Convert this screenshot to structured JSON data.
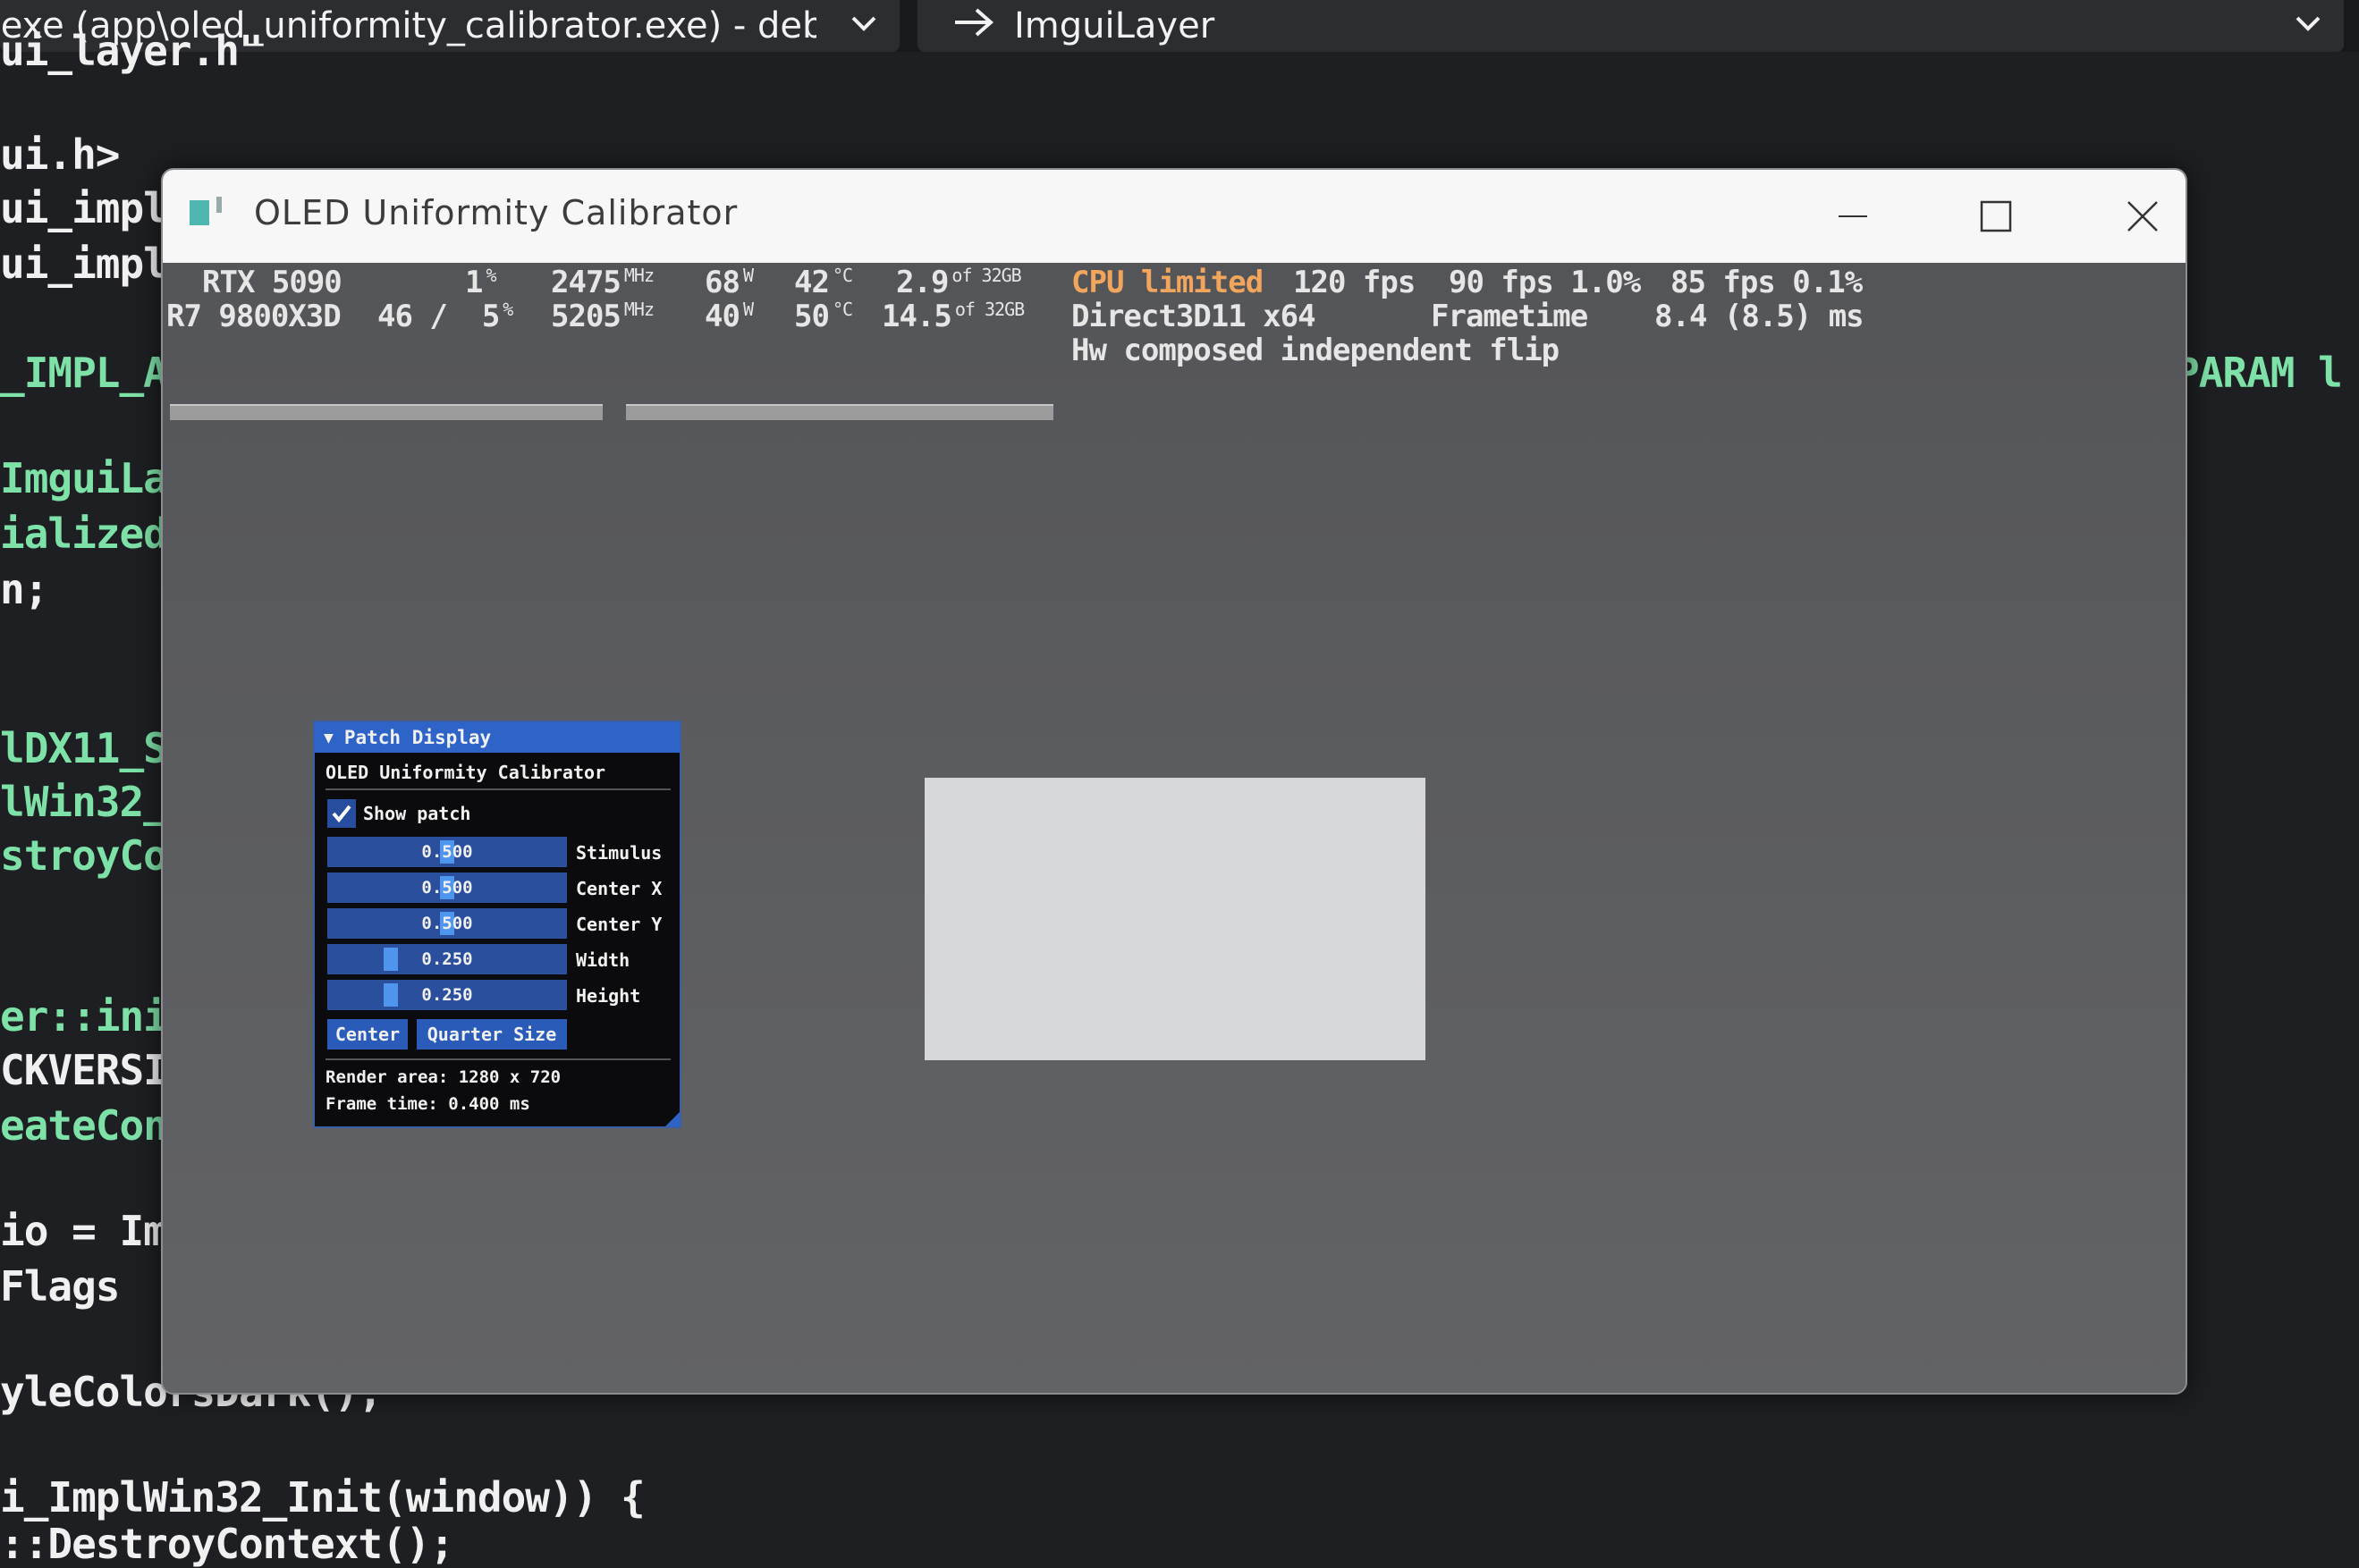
{
  "ide": {
    "config_dropdown": ".exe (app\\oled_uniformity_calibrator.exe) - debu",
    "member_dropdown": "ImguiLayer",
    "code_lines_left": [
      "ui_layer.h\"",
      "ui.h>",
      "ui_impl",
      "ui_impl",
      "_IMPL_AP",
      "ImguiLa",
      "ialized",
      "n;",
      "lDX11_S",
      "lWin32_",
      "stroyCo",
      "er::ini",
      "CKVERSI",
      "eateCon",
      "io = Im",
      "Flags",
      "yleColorsDark();",
      "i_ImplWin32_Init(window)) {",
      "::DestroyContext();"
    ],
    "code_right": "PARAM l"
  },
  "window": {
    "title": "OLED Uniformity Calibrator"
  },
  "overlay": {
    "gpu": {
      "name": "RTX 5090",
      "load": "1",
      "clock": "2475",
      "power": "68",
      "temp": "42",
      "mem": "2.9",
      "mem_total": "of 32GB"
    },
    "cpu": {
      "name": "R7 9800X3D",
      "load": "46 /  5",
      "clock": "5205",
      "power": "40",
      "temp": "50",
      "mem": "14.5",
      "mem_total": "of 32GB"
    },
    "units": {
      "pct": "%",
      "mhz": "MHz",
      "w": "W",
      "c": "°C"
    },
    "status": "CPU limited",
    "fps": "120 fps",
    "fps_1pct": "90 fps 1.0%",
    "fps_01pct": "85 fps 0.1%",
    "api": "Direct3D11 x64",
    "frametime_label": "Frametime",
    "frametime_value": "8.4 (8.5) ms",
    "present_mode": "Hw composed independent flip"
  },
  "imgui": {
    "panel_title": "Patch Display",
    "header": "OLED Uniformity Calibrator",
    "show_patch_label": "Show patch",
    "show_patch_checked": true,
    "sliders": [
      {
        "label": "Stimulus",
        "value": "0.500",
        "fraction": 0.5
      },
      {
        "label": "Center X",
        "value": "0.500",
        "fraction": 0.5
      },
      {
        "label": "Center Y",
        "value": "0.500",
        "fraction": 0.5
      },
      {
        "label": "Width",
        "value": "0.250",
        "fraction": 0.25
      },
      {
        "label": "Height",
        "value": "0.250",
        "fraction": 0.25
      }
    ],
    "button_center": "Center",
    "button_quarter": "Quarter Size",
    "render_area": "Render area: 1280 x 720",
    "frame_time": "Frame time: 0.400 ms"
  }
}
